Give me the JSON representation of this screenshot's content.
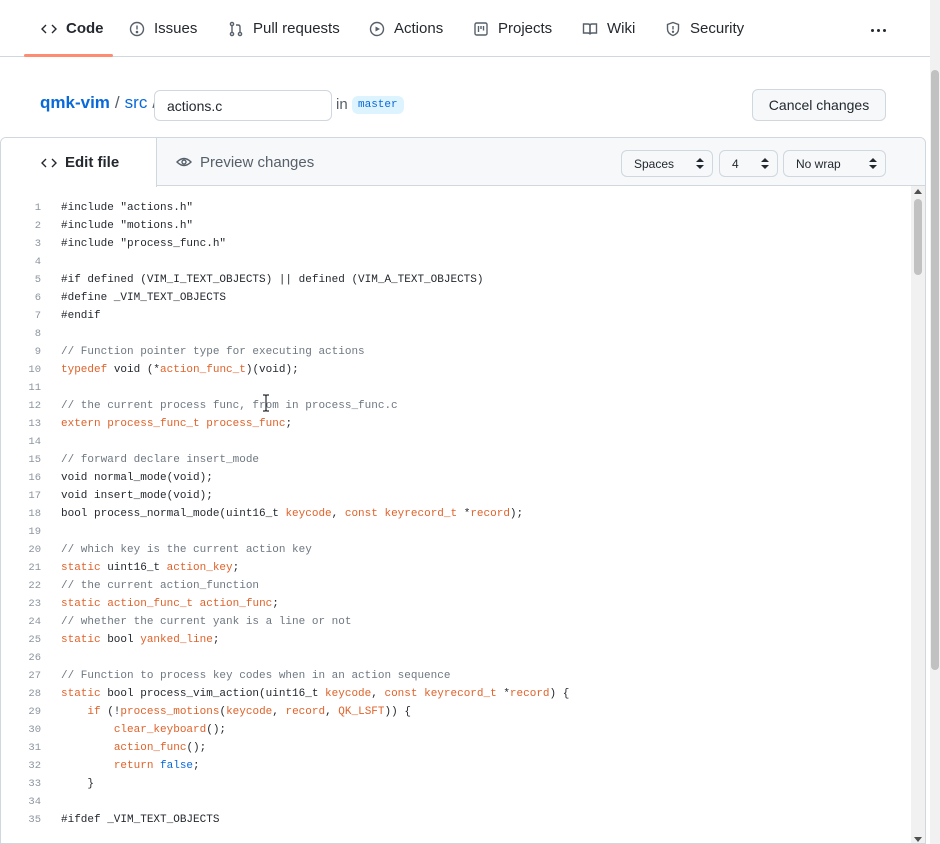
{
  "nav": {
    "tabs": [
      {
        "label": "Code",
        "icon": "code-icon",
        "active": true
      },
      {
        "label": "Issues",
        "icon": "issue-icon"
      },
      {
        "label": "Pull requests",
        "icon": "pull-request-icon"
      },
      {
        "label": "Actions",
        "icon": "play-icon"
      },
      {
        "label": "Projects",
        "icon": "project-icon"
      },
      {
        "label": "Wiki",
        "icon": "book-icon"
      },
      {
        "label": "Security",
        "icon": "shield-icon"
      }
    ],
    "more_icon": "kebab-horizontal-icon"
  },
  "breadcrumb": {
    "repo": "qmk-vim",
    "sep1": "/",
    "dir": "src",
    "sep2": "/"
  },
  "filename": {
    "value": "actions.c"
  },
  "in_label": "in",
  "branch": "master",
  "cancel_label": "Cancel changes",
  "editor": {
    "edit_tab": "Edit file",
    "preview_tab": "Preview changes",
    "indent_mode": "Spaces",
    "indent_size": "4",
    "wrap_mode": "No wrap"
  },
  "colors": {
    "accent": "#0969da",
    "tab_underline": "#fd8c73",
    "syntax_keyword": "#e0622a",
    "syntax_comment": "#6e7781",
    "branch_bg": "#ddf4ff"
  },
  "code_lines": [
    {
      "n": "1",
      "t": "#include \"actions.h\""
    },
    {
      "n": "2",
      "t": "#include \"motions.h\""
    },
    {
      "n": "3",
      "t": "#include \"process_func.h\""
    },
    {
      "n": "4",
      "t": ""
    },
    {
      "n": "5",
      "t": "#if defined (VIM_I_TEXT_OBJECTS) || defined (VIM_A_TEXT_OBJECTS)"
    },
    {
      "n": "6",
      "t": "#define _VIM_TEXT_OBJECTS"
    },
    {
      "n": "7",
      "t": "#endif"
    },
    {
      "n": "8",
      "t": ""
    },
    {
      "n": "9",
      "t": "// Function pointer type for executing actions"
    },
    {
      "n": "10",
      "t": "typedef void (*action_func_t)(void);"
    },
    {
      "n": "11",
      "t": ""
    },
    {
      "n": "12",
      "t": "// the current process func, from in process_func.c"
    },
    {
      "n": "13",
      "t": "extern process_func_t process_func;"
    },
    {
      "n": "14",
      "t": ""
    },
    {
      "n": "15",
      "t": "// forward declare insert_mode"
    },
    {
      "n": "16",
      "t": "void normal_mode(void);"
    },
    {
      "n": "17",
      "t": "void insert_mode(void);"
    },
    {
      "n": "18",
      "t": "bool process_normal_mode(uint16_t keycode, const keyrecord_t *record);"
    },
    {
      "n": "19",
      "t": ""
    },
    {
      "n": "20",
      "t": "// which key is the current action key"
    },
    {
      "n": "21",
      "t": "static uint16_t action_key;"
    },
    {
      "n": "22",
      "t": "// the current action_function"
    },
    {
      "n": "23",
      "t": "static action_func_t action_func;"
    },
    {
      "n": "24",
      "t": "// whether the current yank is a line or not"
    },
    {
      "n": "25",
      "t": "static bool yanked_line;"
    },
    {
      "n": "26",
      "t": ""
    },
    {
      "n": "27",
      "t": "// Function to process key codes when in an action sequence"
    },
    {
      "n": "28",
      "t": "static bool process_vim_action(uint16_t keycode, const keyrecord_t *record) {"
    },
    {
      "n": "29",
      "t": "    if (!process_motions(keycode, record, QK_LSFT)) {"
    },
    {
      "n": "30",
      "t": "        clear_keyboard();"
    },
    {
      "n": "31",
      "t": "        action_func();"
    },
    {
      "n": "32",
      "t": "        return false;"
    },
    {
      "n": "33",
      "t": "    }"
    },
    {
      "n": "34",
      "t": ""
    },
    {
      "n": "35",
      "t": "#ifdef _VIM_TEXT_OBJECTS"
    }
  ]
}
